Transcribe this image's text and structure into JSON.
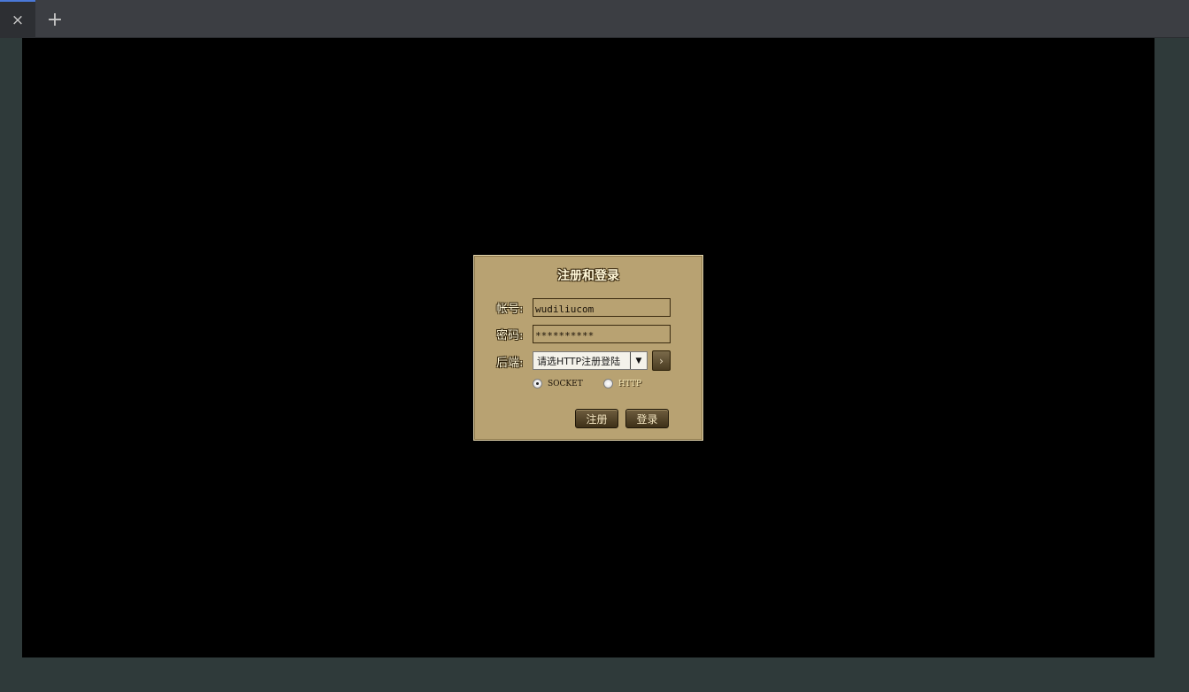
{
  "browser": {
    "tab_close_glyph": "×",
    "new_tab_glyph": "+",
    "accent_color": "#4a78d8"
  },
  "dialog": {
    "title": "注册和登录",
    "account": {
      "label": "帐号:",
      "value": "wudiliucom"
    },
    "password": {
      "label": "密码:",
      "value": "**********"
    },
    "backend": {
      "label": "后端:",
      "selected": "请选HTTP注册登陆",
      "go_glyph": "›"
    },
    "protocols": [
      {
        "label": "SOCKET",
        "checked": true
      },
      {
        "label": "HTTP",
        "checked": false
      }
    ],
    "register_label": "注册",
    "login_label": "登录",
    "colors": {
      "panel": "#b8a272",
      "button": "#4e3f24",
      "text_light": "#fff7d8"
    }
  }
}
